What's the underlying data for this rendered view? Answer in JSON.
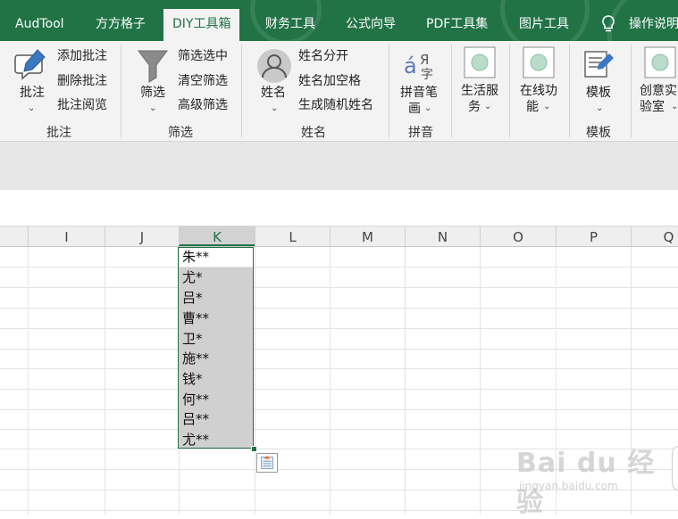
{
  "tabs": [
    {
      "label": "AudTool",
      "active": false
    },
    {
      "label": "方方格子",
      "active": false
    },
    {
      "label": "DIY工具箱",
      "active": true
    },
    {
      "label": "财务工具",
      "active": false
    },
    {
      "label": "公式向导",
      "active": false
    },
    {
      "label": "PDF工具集",
      "active": false
    },
    {
      "label": "图片工具",
      "active": false
    },
    {
      "label": "操作说明",
      "active": false
    }
  ],
  "ribbon": {
    "comments": {
      "big": "批注",
      "items": [
        "添加批注",
        "删除批注",
        "批注阅览"
      ],
      "group": "批注"
    },
    "filter": {
      "big": "筛选",
      "items": [
        "筛选选中",
        "清空筛选",
        "高级筛选"
      ],
      "group": "筛选"
    },
    "name": {
      "big": "姓名",
      "items": [
        "姓名分开",
        "姓名加空格",
        "生成随机姓名"
      ],
      "group": "姓名"
    },
    "pinyin": {
      "big_line1": "拼音笔",
      "big_line2": "画",
      "group": "拼音"
    },
    "life": {
      "line1": "生活服",
      "line2": "务"
    },
    "online": {
      "line1": "在线功",
      "line2": "能"
    },
    "template": {
      "big": "模板",
      "group": "模板"
    },
    "creative": {
      "line1": "创意实",
      "line2": "验室"
    }
  },
  "columns": [
    "I",
    "J",
    "K",
    "L",
    "M",
    "N",
    "O",
    "P",
    "Q"
  ],
  "selected_column": "K",
  "cells": [
    "朱**",
    "尤*",
    "吕*",
    "曹**",
    "卫*",
    "施**",
    "钱*",
    "何**",
    "吕**",
    "尤**"
  ],
  "watermark": {
    "main": "Bai du 经验",
    "sub": "jingyan.baidu.com"
  },
  "colors": {
    "accent": "#217346",
    "selection": "#d0d0d0"
  }
}
